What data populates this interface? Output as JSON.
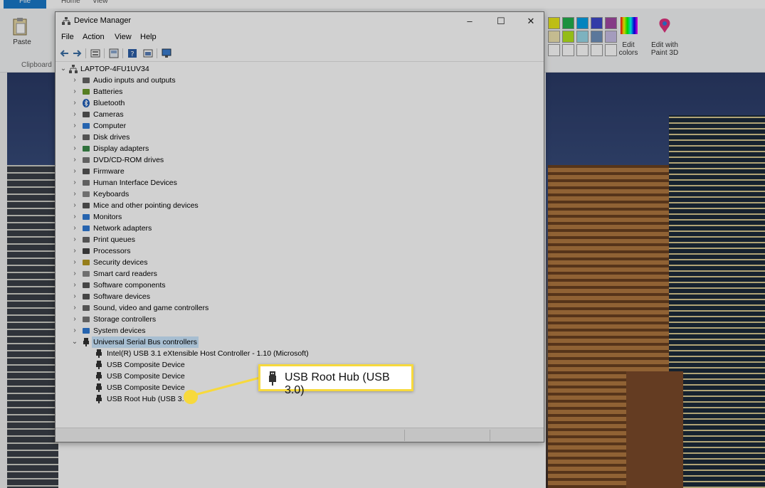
{
  "paint": {
    "tabs": [
      "File",
      "Home",
      "View"
    ],
    "paste_label": "Paste",
    "clipboard_label": "Clipboard",
    "edit_colors_label": "Edit colors",
    "edit_paint3d_label": "Edit with Paint 3D"
  },
  "window": {
    "title": "Device Manager",
    "minimize": "–",
    "maximize": "☐",
    "close": "✕"
  },
  "menu": [
    "File",
    "Action",
    "View",
    "Help"
  ],
  "tree": {
    "root": "LAPTOP-4FU1UV34",
    "categories": [
      {
        "label": "Audio inputs and outputs",
        "icon": "speaker-icon"
      },
      {
        "label": "Batteries",
        "icon": "battery-icon"
      },
      {
        "label": "Bluetooth",
        "icon": "bluetooth-icon"
      },
      {
        "label": "Cameras",
        "icon": "camera-icon"
      },
      {
        "label": "Computer",
        "icon": "computer-icon"
      },
      {
        "label": "Disk drives",
        "icon": "disk-drive-icon"
      },
      {
        "label": "Display adapters",
        "icon": "display-adapter-icon"
      },
      {
        "label": "DVD/CD-ROM drives",
        "icon": "dvd-drive-icon"
      },
      {
        "label": "Firmware",
        "icon": "firmware-icon"
      },
      {
        "label": "Human Interface Devices",
        "icon": "hid-icon"
      },
      {
        "label": "Keyboards",
        "icon": "keyboard-icon"
      },
      {
        "label": "Mice and other pointing devices",
        "icon": "mouse-icon"
      },
      {
        "label": "Monitors",
        "icon": "monitor-icon"
      },
      {
        "label": "Network adapters",
        "icon": "network-adapter-icon"
      },
      {
        "label": "Print queues",
        "icon": "printer-icon"
      },
      {
        "label": "Processors",
        "icon": "processor-icon"
      },
      {
        "label": "Security devices",
        "icon": "security-device-icon"
      },
      {
        "label": "Smart card readers",
        "icon": "smart-card-icon"
      },
      {
        "label": "Software components",
        "icon": "software-component-icon"
      },
      {
        "label": "Software devices",
        "icon": "software-device-icon"
      },
      {
        "label": "Sound, video and game controllers",
        "icon": "sound-icon"
      },
      {
        "label": "Storage controllers",
        "icon": "storage-controller-icon"
      },
      {
        "label": "System devices",
        "icon": "system-device-icon"
      },
      {
        "label": "Universal Serial Bus controllers",
        "icon": "usb-icon",
        "expanded": true
      }
    ],
    "usb_children": [
      "Intel(R) USB 3.1 eXtensible Host Controller - 1.10 (Microsoft)",
      "USB Composite Device",
      "USB Composite Device",
      "USB Composite Device",
      "USB Root Hub (USB 3.0)"
    ]
  },
  "callout": {
    "label": "USB Root Hub (USB 3.0)"
  },
  "colors": {
    "accent_yellow": "#f7d93c",
    "selection_blue": "#cce8ff",
    "paint_file_tab": "#1979ca"
  }
}
